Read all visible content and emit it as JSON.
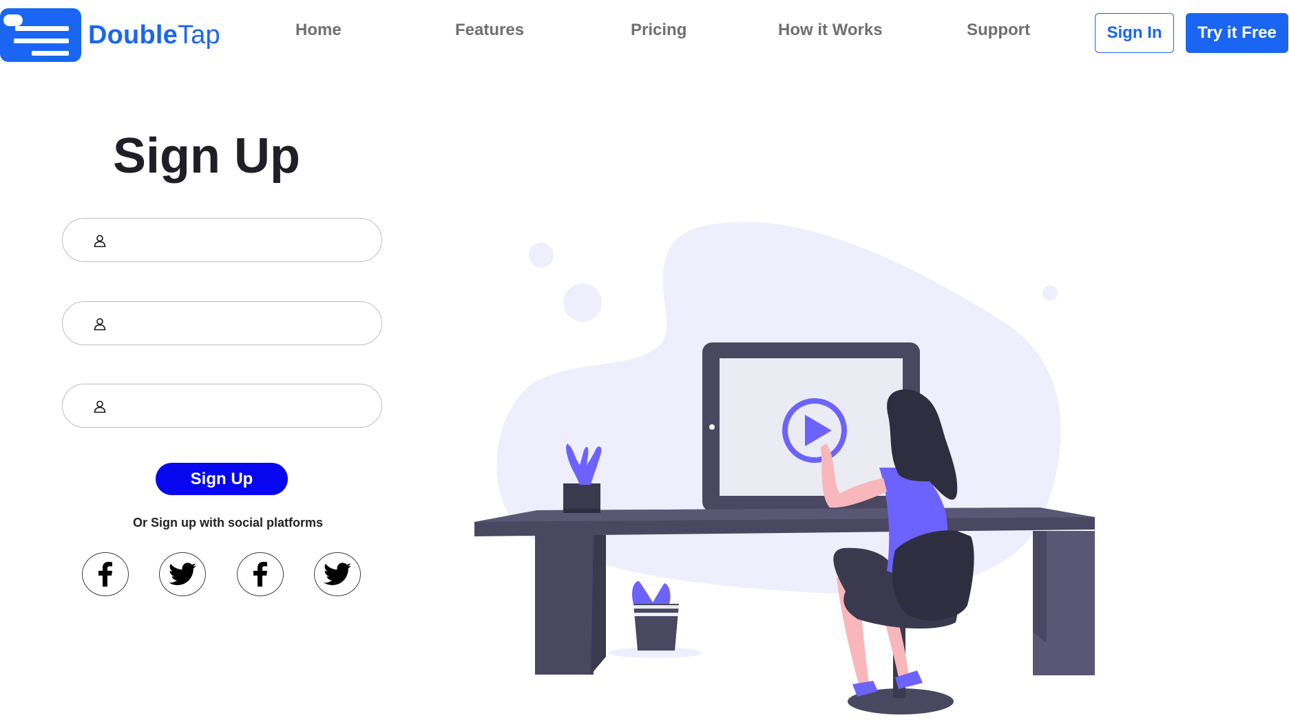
{
  "brand": {
    "name_bold": "Double",
    "name_regular": "Tap",
    "color": "#1a66f2"
  },
  "nav": {
    "items": [
      {
        "label": "Home"
      },
      {
        "label": "Features"
      },
      {
        "label": "Pricing"
      },
      {
        "label": "How it Works"
      },
      {
        "label": "Support"
      }
    ],
    "signin_label": "Sign In",
    "try_label": "Try it Free"
  },
  "form": {
    "title": "Sign Up",
    "fields": [
      {
        "icon": "user-icon",
        "value": ""
      },
      {
        "icon": "user-icon",
        "value": ""
      },
      {
        "icon": "user-icon",
        "value": ""
      }
    ],
    "submit_label": "Sign Up",
    "social_text": "Or Sign up with social platforms",
    "social_icons": [
      "facebook-icon",
      "twitter-icon",
      "facebook-icon",
      "twitter-icon"
    ],
    "submit_color": "#0707f0"
  },
  "illustration": {
    "accent": "#6c63ff",
    "blob": "#efeefc",
    "desk": "#4a4760"
  }
}
